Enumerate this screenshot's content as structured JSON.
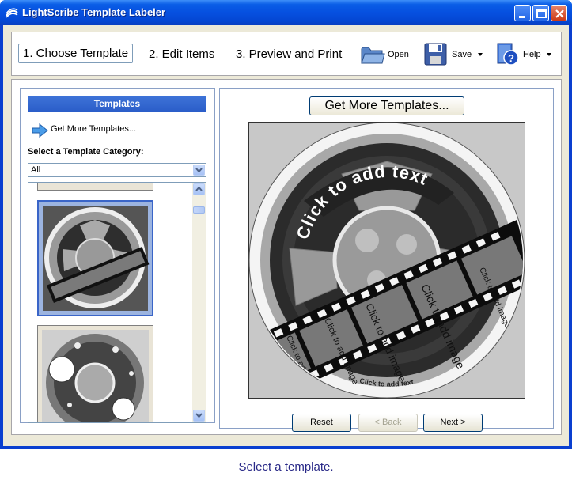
{
  "window": {
    "title": "LightScribe Template Labeler"
  },
  "toolbar": {
    "steps": [
      "1. Choose Template",
      "2. Edit Items",
      "3. Preview and Print"
    ],
    "open_label": "Open",
    "save_label": "Save",
    "help_label": "Help"
  },
  "left_panel": {
    "header": "Templates",
    "get_more_link": "Get More Templates...",
    "category_label": "Select a Template Category:",
    "category_selected": "All"
  },
  "right_panel": {
    "get_more_button": "Get More Templates...",
    "disc_text": {
      "main_arc": "Click to add text",
      "bottom_arc": "Click to add text",
      "frames": [
        "Click to add image",
        "Click to add image",
        "Click to add image",
        "Click to add image",
        "Click to add image"
      ]
    },
    "buttons": {
      "reset": "Reset",
      "back": "< Back",
      "next": "Next >"
    }
  },
  "status": "Select a template.",
  "colors": {
    "title_blue": "#0650e0",
    "accent": "#2a5cc8",
    "status_text": "#2a2a88",
    "client_bg": "#ece9d8"
  }
}
